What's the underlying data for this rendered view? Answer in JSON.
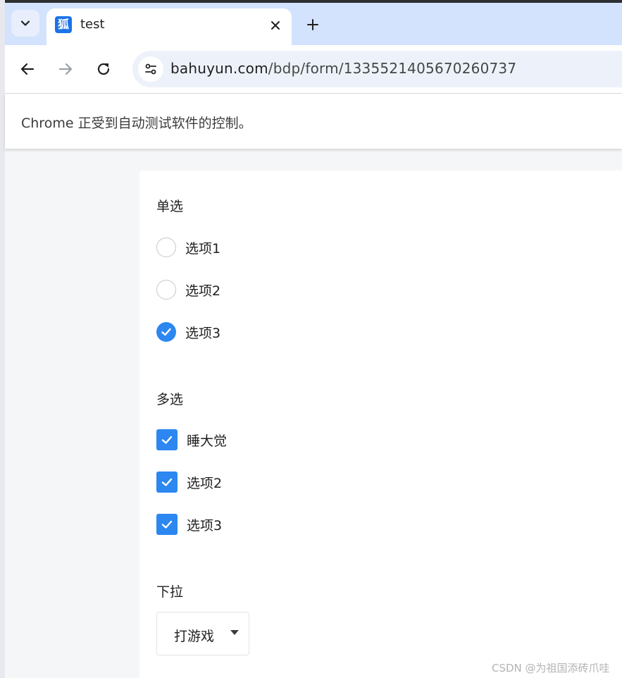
{
  "browser": {
    "tab_title": "test",
    "favicon_glyph": "狐",
    "url_host": "bahuyun.com",
    "url_path": "/bdp/form/1335521405670260737",
    "automation_notice": "Chrome 正受到自动测试软件的控制。",
    "accent_color": "#1a73e8"
  },
  "form": {
    "radio_section": {
      "title": "单选",
      "options": [
        {
          "label": "选项1",
          "checked": false
        },
        {
          "label": "选项2",
          "checked": false
        },
        {
          "label": "选项3",
          "checked": true
        }
      ]
    },
    "checkbox_section": {
      "title": "多选",
      "options": [
        {
          "label": "睡大觉",
          "checked": true
        },
        {
          "label": "选项2",
          "checked": true
        },
        {
          "label": "选项3",
          "checked": true
        }
      ]
    },
    "select_section": {
      "title": "下拉",
      "selected": "打游戏"
    },
    "control_color": "#2c87f0"
  },
  "watermark": "CSDN @为祖国添砖爪哇"
}
